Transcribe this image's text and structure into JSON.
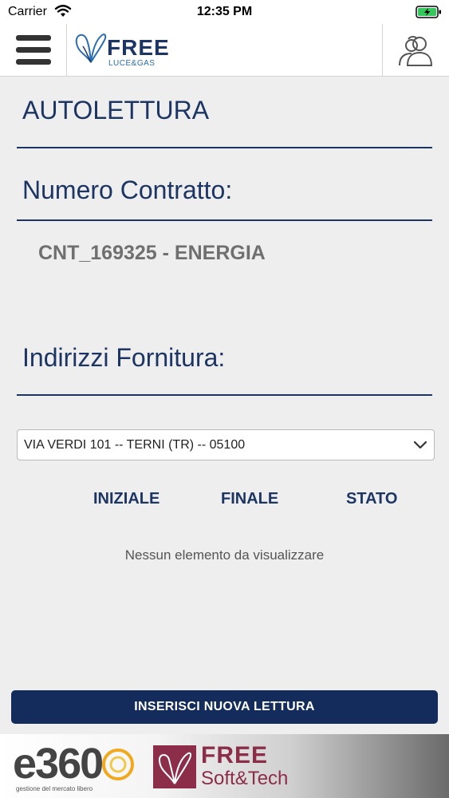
{
  "status_bar": {
    "carrier": "Carrier",
    "time": "12:35 PM",
    "icons": [
      "wifi-icon",
      "battery-charging-icon"
    ]
  },
  "navbar": {
    "menu_icon": "hamburger-menu-icon",
    "logo": {
      "word": "FREE",
      "sub": "LUCE&GAS",
      "icon": "butterfly-icon"
    },
    "user_icon": "users-icon"
  },
  "page": {
    "title": "AUTOLETTURA",
    "contract_label": "Numero Contratto:",
    "contract_value": "CNT_169325 - ENERGIA",
    "supply_label": "Indirizzi Fornitura:",
    "supply_select": {
      "selected": "VIA VERDI 101 -- TERNI (TR) -- 05100",
      "icon": "chevron-down-icon"
    },
    "table": {
      "headers": [
        "INIZIALE",
        "FINALE",
        "STATO"
      ],
      "empty_message": "Nessun elemento da visualizzare"
    },
    "primary_button": "INSERISCI NUOVA LETTURA"
  },
  "footer": {
    "e360": {
      "word": "e360",
      "sub": "gestione del mercato libero"
    },
    "free_soft_tech": {
      "word": "FREE",
      "sub": "Soft&Tech"
    }
  },
  "colors": {
    "brand_navy": "#1d3563",
    "button_navy": "#132c5c",
    "value_gray": "#6f6f6f",
    "page_bg": "#eeeeee",
    "accent_maroon": "#8c2d4a"
  }
}
